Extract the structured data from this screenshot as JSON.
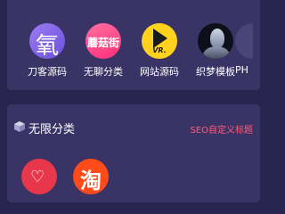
{
  "apps": [
    {
      "label": "刀客源码",
      "icon": "oxygen-char-icon",
      "glyph": "氧",
      "color": "#7f64e8"
    },
    {
      "label": "无聊分类",
      "icon": "mogujie-icon",
      "glyph": "蘑菇街",
      "color": "#ff4d88"
    },
    {
      "label": "网站源码",
      "icon": "vr-play-icon",
      "glyph": "VR.",
      "color": "#ffd21e"
    },
    {
      "label": "织梦模板",
      "icon": "portrait-icon",
      "color": "#0d0f1a"
    },
    {
      "label": "PH",
      "icon": "partial-app-icon"
    }
  ],
  "leading_partial": "!",
  "category": {
    "title": "无限分类",
    "seo_link": "SEO自定义标题",
    "items": [
      {
        "icon": "heart-app-icon",
        "color": "#e8364a"
      },
      {
        "icon": "taobao-icon",
        "glyph": "淘",
        "color": "#ff4a1a"
      }
    ]
  },
  "colors": {
    "background": "#2a2550",
    "panel": "#3a3466",
    "accent": "#ff5a7a"
  }
}
